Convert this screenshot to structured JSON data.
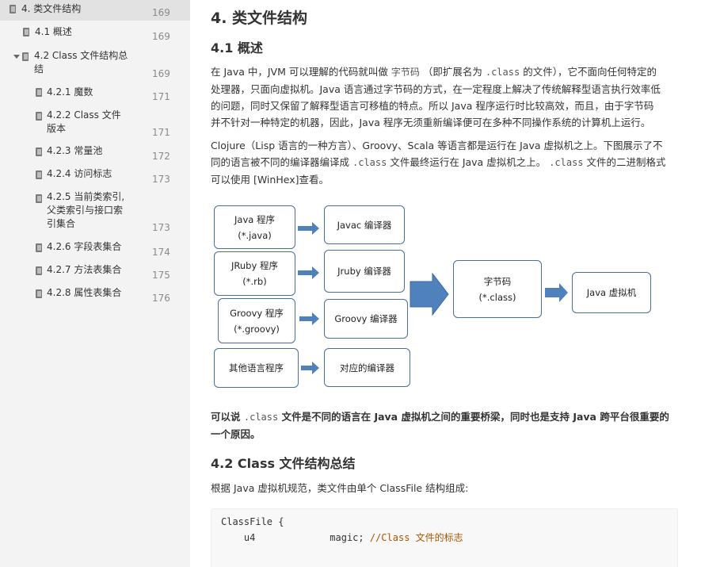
{
  "toc": [
    {
      "label": "4. 类文件结构",
      "page": "169"
    },
    {
      "label": "4.1 概述",
      "page": "169"
    },
    {
      "label": "4.2 Class 文件结构总",
      "label2": "结",
      "page": "169"
    },
    {
      "label": "4.2.1 魔数",
      "page": "171"
    },
    {
      "label": "4.2.2 Class 文件",
      "label2": "版本",
      "page": "171"
    },
    {
      "label": "4.2.3 常量池",
      "page": "172"
    },
    {
      "label": "4.2.4 访问标志",
      "page": "173"
    },
    {
      "label": "4.2.5 当前类索引,",
      "label2": "父类索引与接口索",
      "label3": "引集合",
      "page": "173"
    },
    {
      "label": "4.2.6 字段表集合",
      "page": "174"
    },
    {
      "label": "4.2.7 方法表集合",
      "page": "175"
    },
    {
      "label": "4.2.8 属性表集合",
      "page": "176"
    }
  ],
  "main": {
    "h1": "4. 类文件结构",
    "h2_overview": "4.1 概述",
    "p1": {
      "a": "在 Java 中，JVM 可以理解的代码就叫做",
      "code1": "字节码",
      "b": "（即扩展名为",
      "code2": ".class",
      "c": "的文件），它不面向任何特定的",
      "line2": "处理器，只面向虚拟机。Java 语言通过字节码的方式，在一定程度上解决了传统解释型语言执行效率低",
      "line3": "的问题，同时又保留了解释型语言可移植的特点。所以 Java 程序运行时比较高效，而且，由于字节码",
      "line4": "并不针对一种特定的机器，因此，Java 程序无须重新编译便可在多种不同操作系统的计算机上运行。"
    },
    "p2": {
      "line1": "Clojure（Lisp 语言的一种方言）、Groovy、Scala 等语言都是运行在 Java 虚拟机之上。下图展示了不",
      "line2a": "同的语言被不同的编译器编译成",
      "code": ".class",
      "line2b": "文件最终运行在 Java 虚拟机之上。",
      "code2": ".class",
      "line2c": "文件的二进制格式",
      "line3": "可以使用 [WinHex]查看。"
    },
    "diagram": {
      "java_prog": "Java 程序",
      "java_ext": "(*.java)",
      "jruby_prog": "JRuby 程序",
      "jruby_ext": "(*.rb)",
      "groovy_prog": "Groovy 程序",
      "groovy_ext": "(*.groovy)",
      "other_prog": "其他语言程序",
      "javac": "Javac 编译器",
      "jruby_c": "Jruby 编译器",
      "groovy_c": "Groovy 编译器",
      "other_c": "对应的编译器",
      "bytecode": "字节码",
      "bytecode_ext": "(*.class)",
      "jvm": "Java 虚拟机"
    },
    "p3": {
      "a": "可以说",
      "code": ".class",
      "b": "文件是不同的语言在 Java 虚拟机之间的重要桥梁，同时也是支持 Java 跨平台很重要的",
      "line2": "一个原因。"
    },
    "h2_summary": "4.2 Class 文件结构总结",
    "p4": "根据 Java 虚拟机规范，类文件由单个 ClassFile 结构组成:",
    "code": {
      "line1": "ClassFile {",
      "line2_type": "    u4             magic;",
      "line2_comment": " //Class 文件的标志"
    }
  },
  "colors": {
    "sidebar_bg": "#f3f3f3",
    "box_border": "#4a6d9c",
    "arrow": "#4f81bd"
  }
}
